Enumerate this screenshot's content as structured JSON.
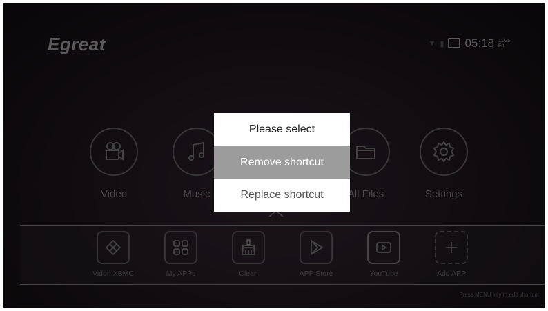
{
  "header": {
    "logo": "Egreat",
    "time": "05:18",
    "date": "11/25",
    "weekday": "Fri."
  },
  "apps": [
    {
      "label": "Video",
      "icon": "video-camera-icon"
    },
    {
      "label": "Music",
      "icon": "music-note-icon"
    },
    {
      "label": "",
      "icon": "app-icon"
    },
    {
      "label": "All Files",
      "icon": "folder-icon"
    },
    {
      "label": "Settings",
      "icon": "gear-icon"
    }
  ],
  "shortcuts": [
    {
      "label": "Vidon XBMC",
      "icon": "xbmc-icon"
    },
    {
      "label": "My APPs",
      "icon": "grid-icon"
    },
    {
      "label": "Clean",
      "icon": "broom-icon"
    },
    {
      "label": "APP Store",
      "icon": "play-store-icon"
    },
    {
      "label": "YouTube",
      "icon": "youtube-icon"
    },
    {
      "label": "Add APP",
      "icon": "plus-icon"
    }
  ],
  "hint": "Press MENU key to edit shortcut",
  "dialog": {
    "title": "Please select",
    "options": [
      "Remove shortcut",
      "Replace shortcut"
    ],
    "selected_index": 0
  }
}
